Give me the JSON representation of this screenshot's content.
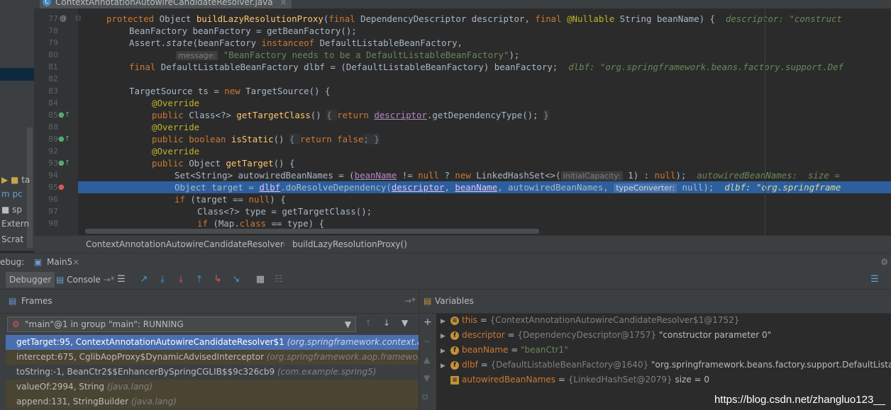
{
  "editor": {
    "tab_label": "ContextAnnotationAutowireCandidateResolver.java",
    "tab_close": "×",
    "line_numbers": [
      "77",
      "78",
      "79",
      "80",
      "81",
      "82",
      "83",
      "84",
      "85",
      "88",
      "89",
      "92",
      "93",
      "94",
      "95",
      "96",
      "97",
      "98"
    ],
    "code": {
      "l77": [
        "protected ",
        "Object ",
        "buildLazyResolutionProxy",
        "(",
        "final ",
        "DependencyDescriptor descriptor, ",
        "final ",
        "@Nullable ",
        "String beanName) {"
      ],
      "l77_hint": "descriptor: \"construct",
      "l78": "BeanFactory beanFactory = getBeanFactory();",
      "l79a": "Assert.",
      "l79b": "state",
      "l79c": "(beanFactory ",
      "l79d": "instanceof ",
      "l79e": "DefaultListableBeanFactory,",
      "l80_hint": "message:",
      "l80_str": "\"BeanFactory needs to be a DefaultListableBeanFactory\"",
      "l80_end": ");",
      "l81a": "final ",
      "l81b": "DefaultListableBeanFactory dlbf = (DefaultListableBeanFactory) beanFactory;",
      "l81_dv": "dlbf: \"org.springframework.beans.factory.support.Def",
      "l83a": "TargetSource ts = ",
      "l83b": "new ",
      "l83c": "TargetSource() {",
      "override": "@Override",
      "l85a": "public ",
      "l85b": "Class<?> ",
      "l85c": "getTargetClass",
      "l85d": "() ",
      "l85e": "{ ",
      "l85f": "return ",
      "l85g": "descriptor",
      "l85h": ".getDependencyType(); ",
      "l85i": "}",
      "l89a": "public boolean ",
      "l89b": "isStatic",
      "l89c": "() ",
      "l89d": "{ ",
      "l89e": "return false",
      "l89f": "; }",
      "l93a": "public ",
      "l93b": "Object ",
      "l93c": "getTarget",
      "l93d": "() {",
      "l94a": "Set<String> autowiredBeanNames = (",
      "l94b": "beanName",
      "l94c": " != ",
      "l94d": "null ",
      "l94e": "? ",
      "l94f": "new ",
      "l94g": "LinkedHashSet<>(",
      "l94_hint": "initialCapacity:",
      "l94h": " 1) : ",
      "l94i": "null",
      "l94j": ");",
      "l94_dv": "autowiredBeanNames:  size =",
      "l95a": "Object target = ",
      "l95b": "dlbf",
      "l95c": ".doResolveDependency(",
      "l95d": "descriptor",
      "l95e": ", ",
      "l95f": "beanName",
      "l95g": ", autowiredBeanNames, ",
      "l95_hint": "typeConverter:",
      "l95h": " null);",
      "l95_dv": "dlbf: \"org.springframe",
      "l96a": "if ",
      "l96b": "(target == ",
      "l96c": "null",
      "l96d": ") {",
      "l97": "Class<?> type = getTargetClass();",
      "l98a": "if ",
      "l98b": "(Map.",
      "l98c": "class ",
      "l98d": "== type) {"
    },
    "breadcrumb": {
      "class_name": "ContextAnnotationAutowireCandidateResolver",
      "method": "buildLazyResolutionProxy()",
      "sep": "›"
    }
  },
  "project_tree": {
    "items": [
      "ta",
      "m pc",
      "sp",
      "Extern",
      "Scrat"
    ]
  },
  "debug": {
    "title_prefix": "ebug:",
    "config_name": "Main5",
    "tabs": {
      "debugger": "Debugger",
      "console": "Console"
    },
    "frames": {
      "header": "Frames",
      "thread": "\"main\"@1 in group \"main\": RUNNING",
      "rows": [
        {
          "method": "getTarget:95, ContextAnnotationAutowireCandidateResolver$1 ",
          "pkg": "(org.springframework.context.anno"
        },
        {
          "method": "intercept:675, CglibAopProxy$DynamicAdvisedInterceptor ",
          "pkg": "(org.springframework.aop.framework"
        },
        {
          "method": "toString:-1, BeanCtr2$$EnhancerBySpringCGLIB$$9c326cb9 ",
          "pkg": "(com.example.spring5)"
        },
        {
          "method": "valueOf:2994, String ",
          "pkg": "(java.lang)"
        },
        {
          "method": "append:131, StringBuilder ",
          "pkg": "(java.lang)"
        }
      ]
    },
    "variables": {
      "header": "Variables",
      "rows": [
        {
          "name": "this",
          "eq": " = ",
          "ref": "{ContextAnnotationAutowireCandidateResolver$1@1752}",
          "val": ""
        },
        {
          "name": "descriptor",
          "eq": " = ",
          "ref": "{DependencyDescriptor@1757}",
          "val": " \"constructor parameter 0\""
        },
        {
          "name": "beanName",
          "eq": " = ",
          "ref": "",
          "val": "\"beanCtr1\""
        },
        {
          "name": "dlbf",
          "eq": " = ",
          "ref": "{DefaultListableBeanFactory@1640}",
          "val": " \"org.springframework.beans.factory.support.DefaultListableB"
        },
        {
          "name": "autowiredBeanNames",
          "eq": " = ",
          "ref": "{LinkedHashSet@2079}",
          "val": "  size = 0"
        }
      ]
    }
  },
  "watermark": "https://blog.csdn.net/zhangluo123__"
}
